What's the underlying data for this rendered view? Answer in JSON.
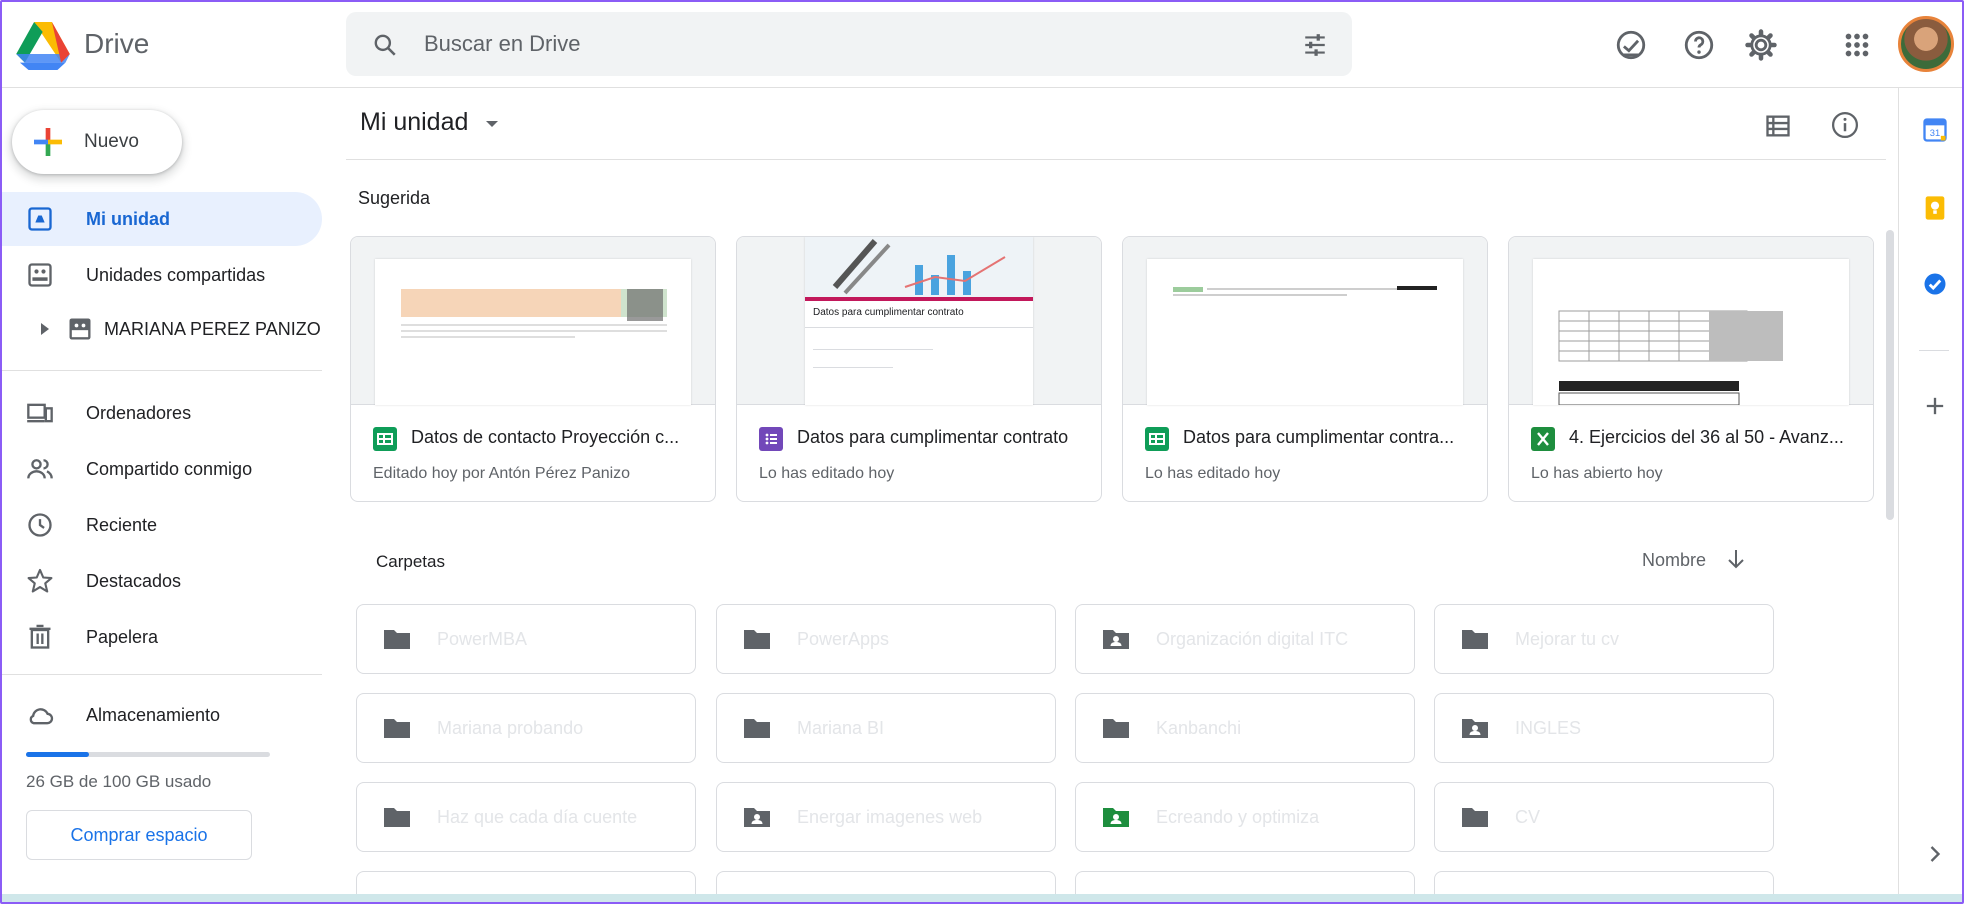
{
  "header": {
    "app_title": "Drive",
    "search_placeholder": "Buscar en Drive"
  },
  "sidebar": {
    "new_label": "Nuevo",
    "items": [
      {
        "label": "Mi unidad",
        "icon": "my-drive-icon",
        "active": true
      },
      {
        "label": "Unidades compartidas",
        "icon": "shared-drives-icon"
      },
      {
        "label": "MARIANA PEREZ PANIZO",
        "icon": "shared-drive-icon"
      },
      {
        "label": "Ordenadores",
        "icon": "computers-icon"
      },
      {
        "label": "Compartido conmigo",
        "icon": "shared-with-me-icon"
      },
      {
        "label": "Reciente",
        "icon": "clock-icon"
      },
      {
        "label": "Destacados",
        "icon": "star-icon"
      },
      {
        "label": "Papelera",
        "icon": "trash-icon"
      },
      {
        "label": "Almacenamiento",
        "icon": "cloud-icon"
      }
    ],
    "storage": {
      "used_fraction": 0.26,
      "text": "26 GB de 100 GB usado",
      "buy_label": "Comprar espacio"
    }
  },
  "main": {
    "title": "Mi unidad",
    "suggested_label": "Sugerida",
    "cards": [
      {
        "name": "Datos de contacto Proyección c...",
        "sub": "Editado hoy por Antón Pérez Panizo",
        "type": "sheets",
        "type_color": "#0f9d58"
      },
      {
        "name": "Datos para cumplimentar contrato",
        "sub": "Lo has editado hoy",
        "type": "forms",
        "type_color": "#7248b9"
      },
      {
        "name": "Datos para cumplimentar contra...",
        "sub": "Lo has editado hoy",
        "type": "sheets",
        "type_color": "#0f9d58"
      },
      {
        "name": "4. Ejercicios del 36 al 50 - Avanz...",
        "sub": "Lo has abierto hoy",
        "type": "excel",
        "type_color": "#1e8e3e"
      }
    ],
    "thumb2": {
      "form_title": "Datos para cumplimentar contrato"
    },
    "folders_label": "Carpetas",
    "sort_label": "Nombre",
    "folders": [
      {
        "name": "PowerMBA",
        "shared": false
      },
      {
        "name": "PowerApps",
        "shared": false
      },
      {
        "name": "Organización digital ITC",
        "shared": true
      },
      {
        "name": "Mejorar tu cv",
        "shared": false
      },
      {
        "name": "Mariana probando",
        "shared": false
      },
      {
        "name": "Mariana BI",
        "shared": false
      },
      {
        "name": "Kanbanchi",
        "shared": false
      },
      {
        "name": "INGLES",
        "shared": true
      },
      {
        "name": "Haz que cada día cuente",
        "shared": false
      },
      {
        "name": "Energar imagenes web",
        "shared": true
      },
      {
        "name": "Ecreando y optimiza",
        "shared": true,
        "color": "#1e8e3e"
      },
      {
        "name": "CV",
        "shared": false
      }
    ]
  },
  "colors": {
    "accent": "#1a73e8",
    "active_bg": "#e8f0fe"
  }
}
